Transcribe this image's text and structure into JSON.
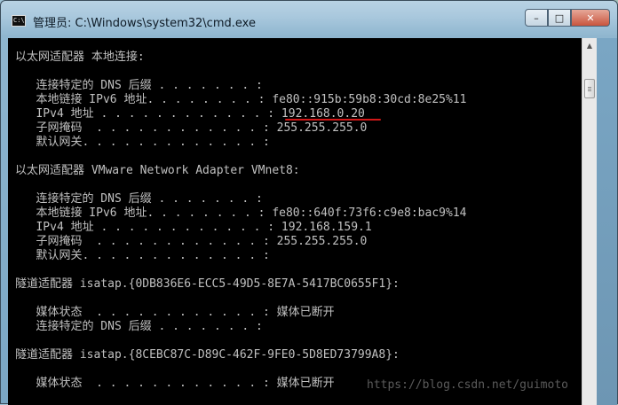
{
  "window": {
    "title": "管理员: C:\\Windows\\system32\\cmd.exe",
    "app_icon_text": "C:\\",
    "buttons": {
      "minimize": "–",
      "maximize": "□",
      "close": "✕"
    }
  },
  "console": {
    "lines": [
      "以太网适配器 本地连接:",
      "",
      "   连接特定的 DNS 后缀 . . . . . . . :",
      "   本地链接 IPv6 地址. . . . . . . . : fe80::915b:59b8:30cd:8e25%11",
      "   IPv4 地址 . . . . . . . . . . . . : 192.168.0.20",
      "   子网掩码  . . . . . . . . . . . . : 255.255.255.0",
      "   默认网关. . . . . . . . . . . . . :",
      "",
      "以太网适配器 VMware Network Adapter VMnet8:",
      "",
      "   连接特定的 DNS 后缀 . . . . . . . :",
      "   本地链接 IPv6 地址. . . . . . . . : fe80::640f:73f6:c9e8:bac9%14",
      "   IPv4 地址 . . . . . . . . . . . . : 192.168.159.1",
      "   子网掩码  . . . . . . . . . . . . : 255.255.255.0",
      "   默认网关. . . . . . . . . . . . . :",
      "",
      "隧道适配器 isatap.{0DB836E6-ECC5-49D5-8E7A-5417BC0655F1}:",
      "",
      "   媒体状态  . . . . . . . . . . . . : 媒体已断开",
      "   连接特定的 DNS 后缀 . . . . . . . :",
      "",
      "隧道适配器 isatap.{8CEBC87C-D89C-462F-9FE0-5D8ED73799A8}:",
      "",
      "   媒体状态  . . . . . . . . . . . . : 媒体已断开"
    ],
    "watermark": "https://blog.csdn.net/guimoto"
  },
  "colors": {
    "console_bg": "#000000",
    "console_text": "#c0c0c0",
    "underline": "#d21818"
  }
}
